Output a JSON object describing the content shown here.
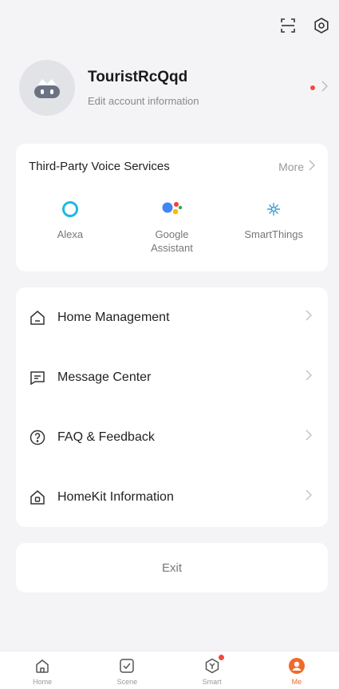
{
  "topbar": {
    "scan_icon": "scan-icon",
    "settings_icon": "settings-icon"
  },
  "profile": {
    "name": "TouristRcQqd",
    "edit_text": "Edit account information",
    "has_notification": true
  },
  "voice_services": {
    "title": "Third-Party Voice Services",
    "more_label": "More",
    "items": [
      {
        "label": "Alexa",
        "icon": "alexa-icon"
      },
      {
        "label": "Google\nAssistant",
        "icon": "google-assistant-icon"
      },
      {
        "label": "SmartThings",
        "icon": "smartthings-icon"
      }
    ]
  },
  "menu": {
    "items": [
      {
        "label": "Home Management",
        "icon": "home-icon"
      },
      {
        "label": "Message Center",
        "icon": "message-icon"
      },
      {
        "label": "FAQ & Feedback",
        "icon": "question-icon"
      },
      {
        "label": "HomeKit Information",
        "icon": "homekit-icon"
      }
    ]
  },
  "exit": {
    "label": "Exit"
  },
  "tabbar": {
    "items": [
      {
        "label": "Home",
        "icon": "home-tab-icon",
        "active": false
      },
      {
        "label": "Scene",
        "icon": "scene-tab-icon",
        "active": false
      },
      {
        "label": "Smart",
        "icon": "smart-tab-icon",
        "active": false,
        "badge": true
      },
      {
        "label": "Me",
        "icon": "me-tab-icon",
        "active": true
      }
    ]
  },
  "colors": {
    "accent": "#f06a2a",
    "badge": "#f04a3e",
    "background": "#f4f4f6",
    "card": "#ffffff"
  }
}
